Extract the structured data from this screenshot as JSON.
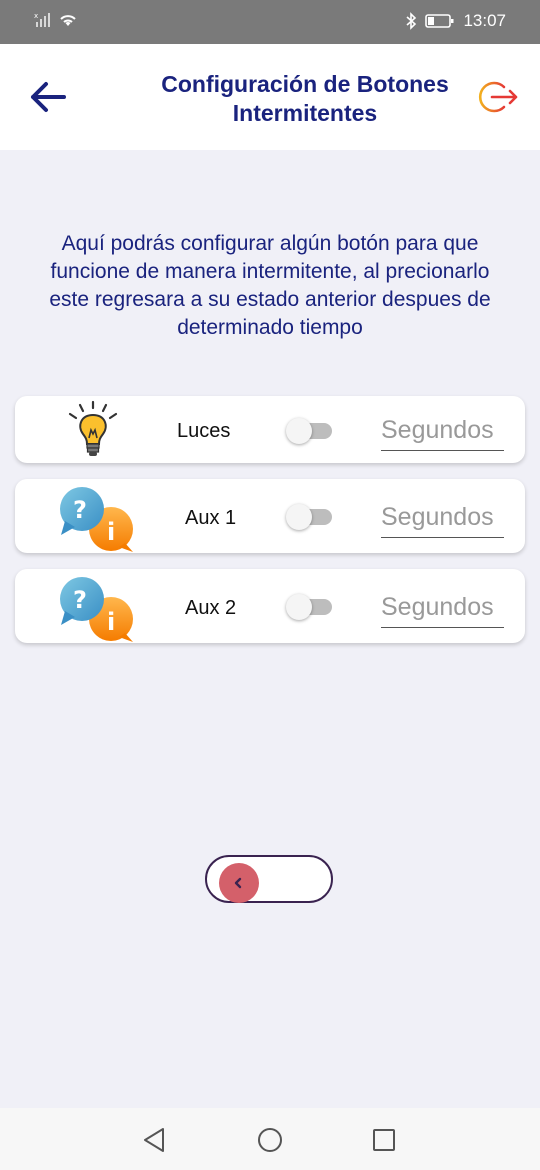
{
  "status_bar": {
    "time": "13:07",
    "icons": [
      "no-signal-icon",
      "wifi-icon",
      "bluetooth-icon",
      "battery-icon"
    ]
  },
  "header": {
    "title_line1": "Configuración de Botones",
    "title_line2": "Intermitentes",
    "back_icon": "arrow-left-icon",
    "logout_icon": "logout-icon",
    "title_color": "#1a237e"
  },
  "description": "Aquí podrás configurar algún botón para que funcione de manera intermitente, al precionarlo este regresara a su estado anterior despues de determinado tiempo",
  "buttons": [
    {
      "label": "Luces",
      "icon": "lightbulb-icon",
      "enabled": false,
      "seconds_placeholder": "Segundos"
    },
    {
      "label": "Aux 1",
      "icon": "question-info-icon",
      "enabled": false,
      "seconds_placeholder": "Segundos"
    },
    {
      "label": "Aux 2",
      "icon": "question-info-icon",
      "enabled": false,
      "seconds_placeholder": "Segundos"
    }
  ],
  "bottom_toggle": {
    "icon": "chevron-left-icon",
    "knob_color": "#d4606a"
  },
  "nav_bar": {
    "icons": [
      "nav-back-icon",
      "nav-home-icon",
      "nav-recents-icon"
    ]
  }
}
